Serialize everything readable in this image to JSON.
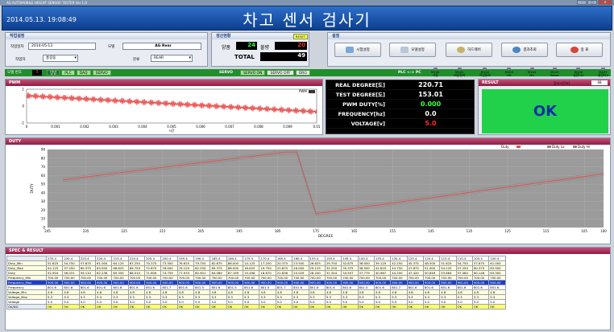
{
  "window": {
    "title": "AG AUTOMOBILE HEIGHT SENSOR TESTER  Ver 1.0",
    "controls": [
      "–",
      "□",
      "✕"
    ]
  },
  "header": {
    "datetime": "2014.05.13. 19:08:49",
    "title": "차고 센서 검사기"
  },
  "work": {
    "section": "작업설정",
    "date_label": "작업일자",
    "date_value": "2014-05-13",
    "model_label": "모델",
    "model_value": "AG Rear",
    "worker_label": "작업자",
    "worker_value": "홍길동",
    "category_label": "분류",
    "category_value": "REAR"
  },
  "production": {
    "section": "생산현황",
    "reset_label": "RESET",
    "good_label": "양품",
    "good_value": "24",
    "bad_label": "불량",
    "bad_value": "20",
    "total_label": "TOTAL",
    "total_value": "49"
  },
  "settings": {
    "section": "설정",
    "buttons": [
      {
        "label": "시험설정",
        "icon": "wrench-icon"
      },
      {
        "label": "모델설정",
        "icon": "clipboard-icon"
      },
      {
        "label": "하드웨어",
        "icon": "key-icon"
      },
      {
        "label": "결과조회",
        "icon": "magnifier-icon"
      },
      {
        "label": "종 료",
        "icon": "power-icon"
      }
    ]
  },
  "statusbar": {
    "model_no_label": "모델 번호",
    "model_no_value": "3",
    "tags": [
      "양압",
      "PLC",
      "DAQ",
      "SERVO"
    ],
    "servo_label": "SERVO",
    "servo_on": "SERVO ON",
    "servo_off": "SERVO OFF",
    "org": "ORG",
    "plc_pc": "PLC <-> PC",
    "lamps": [
      {
        "code": "M100",
        "name": "가동"
      },
      {
        "code": "M101",
        "name": "비상정지"
      },
      {
        "code": "M102",
        "name": "작업완료"
      },
      {
        "code": "M103",
        "name": "OK"
      },
      {
        "code": "M104",
        "name": "NG"
      },
      {
        "code": "M105",
        "name": "Reset"
      },
      {
        "code": "M106",
        "name": "실린더1"
      },
      {
        "code": "M107",
        "name": "실린더2"
      }
    ]
  },
  "pwm": {
    "section": "PWM",
    "legend": "PWM",
    "xlabel": "시간",
    "xticks": [
      "0",
      "0.001",
      "0.002",
      "0.003",
      "0.004",
      "0.005",
      "0.006",
      "0.007",
      "0.008",
      "0.009",
      "0.01"
    ],
    "yticks": [
      "1",
      "0",
      "-1"
    ]
  },
  "measurements": [
    {
      "label": "REAL DEGREE[도]",
      "value": "220.71",
      "color": "#ffffff"
    },
    {
      "label": "TEST DEGREE[도]",
      "value": "153.01",
      "color": "#ffffff"
    },
    {
      "label": "PWM DUTY[%]",
      "value": "0.000",
      "color": "#3cff3c"
    },
    {
      "label": "FREQUENCY[hz]",
      "value": "0.0",
      "color": "#ffffff"
    },
    {
      "label": "VOLTAGE[v]",
      "value": "5.0",
      "color": "#ff2a2a"
    }
  ],
  "result": {
    "section": "RESULT",
    "time_label": "검사시간[s]",
    "time_value": "68",
    "status": "OK"
  },
  "duty": {
    "section": "DUTY",
    "ylabel": "DUTY",
    "xlabel": "DEGREE",
    "legend": [
      "Duty",
      "Duty Lo",
      "Duty Hi"
    ],
    "yticks": [
      "90",
      "80",
      "70",
      "60",
      "50",
      "40",
      "30",
      "20",
      "10",
      "0"
    ],
    "xticks": [
      "245",
      "235",
      "225",
      "215",
      "205",
      "195",
      "185",
      "175",
      "165",
      "155",
      "145",
      "135",
      "125",
      "115",
      "105",
      "100"
    ]
  },
  "chart_data": {
    "type": "line",
    "title": "",
    "xlabel": "DEGREE",
    "ylabel": "DUTY",
    "xlim": [
      245,
      100
    ],
    "ylim": [
      0,
      90
    ],
    "grid": true,
    "legend": "top-right",
    "series": [
      {
        "name": "Duty",
        "color": "#e05050",
        "x": [
          241,
          183,
          180,
          175,
          100
        ],
        "y": [
          55,
          87,
          87,
          16,
          62
        ]
      },
      {
        "name": "Duty Lo",
        "color": "#8a8a8a",
        "x": [
          241,
          183,
          180,
          175,
          100
        ],
        "y": [
          53,
          85,
          85,
          14,
          60
        ]
      },
      {
        "name": "Duty Hi",
        "color": "#8a8a8a",
        "x": [
          241,
          183,
          180,
          175,
          100
        ],
        "y": [
          57,
          89,
          89,
          18,
          64
        ]
      }
    ]
  },
  "spec": {
    "section": "SPEC & RESULT",
    "rows": [
      {
        "label": "",
        "type": "head",
        "cells": [
          "235.4",
          "230.4",
          "225.4",
          "220.4",
          "215.4",
          "210.4",
          "205.4",
          "200.4",
          "195.4",
          "190.4",
          "185.4",
          "180.4",
          "175.4",
          "170.4",
          "165.4",
          "160.4",
          "155.4",
          "150.4",
          "145.4",
          "140.4",
          "135.4",
          "130.4",
          "125.4",
          "120.4",
          "115.4",
          "110.4",
          "105.4",
          "100.4"
        ]
      },
      {
        "label": "Duty_Min",
        "type": "spec",
        "cells": [
          "51.625",
          "54.750",
          "57.875",
          "61.000",
          "64.125",
          "67.250",
          "70.375",
          "73.500",
          "76.625",
          "79.750",
          "82.875",
          "86.000",
          "14.125",
          "17.250",
          "20.375",
          "23.500",
          "26.625",
          "29.750",
          "32.875",
          "36.000",
          "39.125",
          "42.250",
          "45.375",
          "48.500",
          "51.625",
          "54.750",
          "57.875",
          "61.000"
        ]
      },
      {
        "label": "Duty_Max",
        "type": "spec",
        "cells": [
          "54.125",
          "57.250",
          "60.375",
          "63.500",
          "66.625",
          "69.750",
          "72.875",
          "76.000",
          "79.125",
          "82.250",
          "85.375",
          "88.500",
          "16.625",
          "19.750",
          "22.875",
          "26.000",
          "29.125",
          "32.250",
          "35.375",
          "38.500",
          "41.625",
          "44.750",
          "47.875",
          "51.000",
          "54.125",
          "57.250",
          "60.375",
          "63.500"
        ]
      },
      {
        "label": "Duty",
        "type": "spec",
        "cells": [
          "52.904",
          "56.031",
          "59.110",
          "62.236",
          "65.355",
          "68.510",
          "71.609",
          "74.759",
          "77.933",
          "80.901",
          "84.069",
          "87.199",
          "15.496",
          "18.670",
          "21.836",
          "25.029",
          "28.200",
          "31.344",
          "34.557",
          "37.779",
          "40.967",
          "44.200",
          "47.420",
          "50.649",
          "53.864",
          "57.060",
          "60.146",
          "63.300"
        ]
      },
      {
        "label": "Frequency_Min",
        "type": "spec",
        "cells": [
          "700.00",
          "700.00",
          "700.00",
          "700.00",
          "700.00",
          "700.00",
          "700.00",
          "700.00",
          "700.00",
          "700.00",
          "700.00",
          "700.00",
          "700.00",
          "700.00",
          "700.00",
          "700.00",
          "700.00",
          "700.00",
          "700.00",
          "700.00",
          "700.00",
          "700.00",
          "700.00",
          "700.00",
          "700.00",
          "700.00",
          "700.00",
          "700.00"
        ]
      },
      {
        "label": "Frequency_Max",
        "type": "freqmax",
        "cells": [
          "900.00",
          "900.00",
          "900.00",
          "900.00",
          "900.00",
          "900.00",
          "900.00",
          "900.00",
          "900.00",
          "900.00",
          "900.00",
          "900.00",
          "900.00",
          "900.00",
          "900.00",
          "900.00",
          "900.00",
          "900.00",
          "900.00",
          "900.00",
          "900.00",
          "900.00",
          "900.00",
          "900.00",
          "900.00",
          "900.00",
          "900.00",
          "900.00"
        ]
      },
      {
        "label": "Frequency",
        "type": "freq",
        "cells": [
          "801.6",
          "801.6",
          "801.6",
          "801.6",
          "801.6",
          "801.6",
          "801.6",
          "801.7",
          "801.6",
          "801.5",
          "801.6",
          "801.5",
          "801.6",
          "801.5",
          "801.7",
          "801.6",
          "801.6",
          "801.6",
          "801.6",
          "801.5",
          "801.6",
          "801.7",
          "801.6",
          "801.6",
          "801.6",
          "801.6",
          "801.6",
          "801.6"
        ]
      },
      {
        "label": "Voltage_Min",
        "type": "spec",
        "cells": [
          "4.8",
          "4.8",
          "4.8",
          "4.8",
          "4.8",
          "4.8",
          "4.8",
          "4.8",
          "4.8",
          "4.8",
          "4.8",
          "4.8",
          "4.8",
          "4.8",
          "4.8",
          "4.8",
          "4.8",
          "4.8",
          "4.8",
          "4.8",
          "4.8",
          "4.8",
          "4.8",
          "4.8",
          "4.8",
          "4.8",
          "4.8",
          "4.8"
        ]
      },
      {
        "label": "Voltage_Max",
        "type": "spec",
        "cells": [
          "5.3",
          "5.3",
          "5.3",
          "5.3",
          "5.3",
          "5.3",
          "5.3",
          "5.3",
          "5.3",
          "5.3",
          "5.3",
          "5.3",
          "5.3",
          "5.3",
          "5.3",
          "5.3",
          "5.3",
          "5.3",
          "5.3",
          "5.3",
          "5.3",
          "5.3",
          "5.3",
          "5.3",
          "5.3",
          "5.3",
          "5.3",
          "5.3"
        ]
      },
      {
        "label": "Voltage",
        "type": "freq",
        "cells": [
          "5.0",
          "5.0",
          "5.0",
          "5.0",
          "5.0",
          "5.0",
          "5.0",
          "5.0",
          "5.0",
          "5.0",
          "5.0",
          "5.0",
          "5.0",
          "5.0",
          "5.0",
          "5.0",
          "5.0",
          "5.0",
          "5.0",
          "5.0",
          "5.0",
          "5.0",
          "5.0",
          "5.0",
          "5.0",
          "5.0",
          "5.0",
          "5.0"
        ]
      },
      {
        "label": "OK/NG",
        "type": "ok",
        "cells": [
          "OK",
          "OK",
          "OK",
          "OK",
          "OK",
          "OK",
          "OK",
          "OK",
          "OK",
          "OK",
          "OK",
          "OK",
          "OK",
          "OK",
          "OK",
          "OK",
          "OK",
          "OK",
          "OK",
          "OK",
          "OK",
          "OK",
          "OK",
          "OK",
          "OK",
          "OK",
          "OK",
          "OK"
        ]
      }
    ]
  }
}
